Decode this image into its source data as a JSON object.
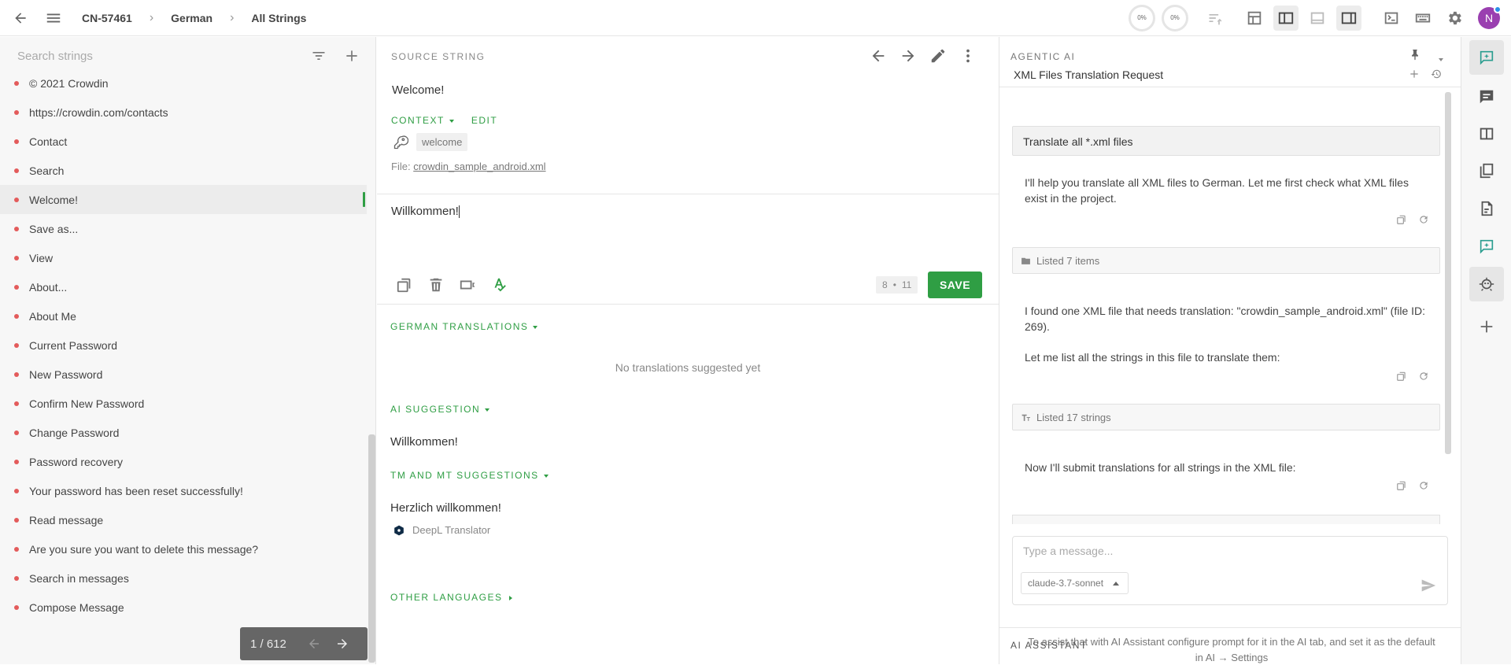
{
  "topbar": {
    "project_id": "CN-57461",
    "language": "German",
    "scope": "All Strings",
    "progress_translated": "0%",
    "progress_approved": "0%",
    "avatar_initial": "N"
  },
  "left": {
    "search_placeholder": "Search strings",
    "strings": [
      {
        "label": "© 2021 Crowdin"
      },
      {
        "label": "https://crowdin.com/contacts"
      },
      {
        "label": "Contact"
      },
      {
        "label": "Search"
      },
      {
        "label": "Welcome!"
      },
      {
        "label": "Save as..."
      },
      {
        "label": "View"
      },
      {
        "label": "About..."
      },
      {
        "label": "About Me"
      },
      {
        "label": "Current Password"
      },
      {
        "label": "New Password"
      },
      {
        "label": "Confirm New Password"
      },
      {
        "label": "Change Password"
      },
      {
        "label": "Password recovery"
      },
      {
        "label": "Your password has been reset successfully!"
      },
      {
        "label": "Read message"
      },
      {
        "label": "Are you sure you want to delete this message?"
      },
      {
        "label": "Search in messages"
      },
      {
        "label": "Compose Message"
      }
    ],
    "selected_index": 4,
    "pager": "1 / 612"
  },
  "center": {
    "source_label": "SOURCE STRING",
    "source_text": "Welcome!",
    "context_label": "CONTEXT",
    "edit_label": "EDIT",
    "context_key": "welcome",
    "file_prefix": "File:",
    "file_name": "crowdin_sample_android.xml",
    "translation_value": "Willkommen!",
    "counter_left": "8",
    "counter_right": "11",
    "save_label": "SAVE",
    "german_translations_label": "GERMAN TRANSLATIONS",
    "no_translations": "No translations suggested yet",
    "ai_suggestion_label": "AI SUGGESTION",
    "ai_suggestion_text": "Willkommen!",
    "tm_mt_label": "TM AND MT SUGGESTIONS",
    "tm_mt_text": "Herzlich willkommen!",
    "tm_mt_source": "DeepL Translator",
    "other_languages_label": "OTHER LANGUAGES"
  },
  "right": {
    "panel_title": "AGENTIC AI",
    "chat_title": "XML Files Translation Request",
    "user_message": "Translate all *.xml files",
    "ai_message_1": "I'll help you translate all XML files to German. Let me first check what XML files exist in the project.",
    "tool_1": "Listed 7 items",
    "ai_message_2a": "I found one XML file that needs translation: \"crowdin_sample_android.xml\" (file ID: 269).",
    "ai_message_2b": "Let me list all the strings in this file to translate them:",
    "tool_2": "Listed 17 strings",
    "ai_message_3": "Now I'll submit translations for all strings in the XML file:",
    "composer_placeholder": "Type a message...",
    "model": "claude-3.7-sonnet",
    "ai_assistant_label": "AI ASSISTANT",
    "ai_assistant_hint": "To assist that with AI Assistant configure prompt for it in the AI tab, and set it as the default in AI → Settings"
  },
  "colors": {
    "accent_green": "#2f9e44",
    "status_red": "#e35b5b",
    "avatar_purple": "#9a3fb0"
  }
}
